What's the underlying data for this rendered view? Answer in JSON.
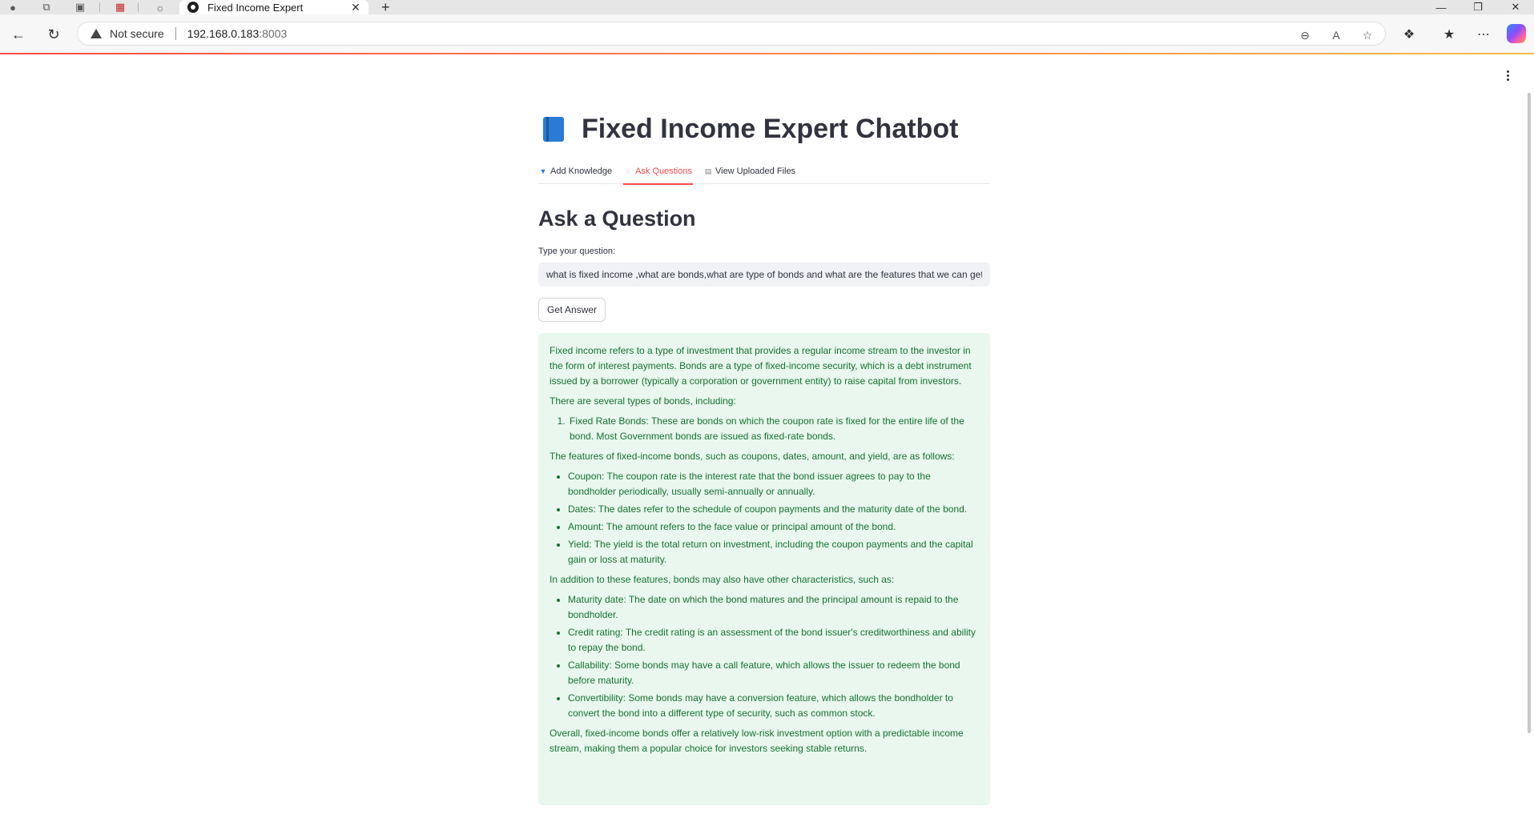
{
  "browser": {
    "tab_title": "Fixed Income Expert",
    "security_label": "Not secure",
    "url_host": "192.168.0.183",
    "url_port": ":8003"
  },
  "app": {
    "title": "Fixed Income Expert Chatbot",
    "title_icon": "blue-book-emoji",
    "tabs": [
      {
        "label": "Add Knowledge",
        "icon": "inbox-tray-icon"
      },
      {
        "label": "Ask Questions",
        "icon": "speech-bubble-icon",
        "active": true
      },
      {
        "label": "View Uploaded Files",
        "icon": "document-icon"
      }
    ],
    "accent_color": "#ff4b4b"
  },
  "ask": {
    "heading": "Ask a Question",
    "input_label": "Type your question:",
    "input_value": "what is fixed income ,what are bonds,what are type of bonds and what are the features that we can get",
    "button_label": "Get Answer"
  },
  "answer": {
    "intro": "Fixed income refers to a type of investment that provides a regular income stream to the investor in the form of interest payments. Bonds are a type of fixed-income security, which is a debt instrument issued by a borrower (typically a corporation or government entity) to raise capital from investors.",
    "types_intro": "There are several types of bonds, including:",
    "types": [
      "Fixed Rate Bonds: These are bonds on which the coupon rate is fixed for the entire life of the bond. Most Government bonds are issued as fixed-rate bonds."
    ],
    "features_intro": "The features of fixed-income bonds, such as coupons, dates, amount, and yield, are as follows:",
    "features": [
      "Coupon: The coupon rate is the interest rate that the bond issuer agrees to pay to the bondholder periodically, usually semi-annually or annually.",
      "Dates: The dates refer to the schedule of coupon payments and the maturity date of the bond.",
      "Amount: The amount refers to the face value or principal amount of the bond.",
      "Yield: The yield is the total return on investment, including the coupon payments and the capital gain or loss at maturity."
    ],
    "other_intro": "In addition to these features, bonds may also have other characteristics, such as:",
    "other": [
      "Maturity date: The date on which the bond matures and the principal amount is repaid to the bondholder.",
      "Credit rating: The credit rating is an assessment of the bond issuer's creditworthiness and ability to repay the bond.",
      "Callability: Some bonds may have a call feature, which allows the issuer to redeem the bond before maturity.",
      "Convertibility: Some bonds may have a conversion feature, which allows the bondholder to convert the bond into a different type of security, such as common stock."
    ],
    "conclusion": "Overall, fixed-income bonds offer a relatively low-risk investment option with a predictable income stream, making them a popular choice for investors seeking stable returns.",
    "background_color": "#e9f7ee",
    "text_color": "#177233"
  }
}
